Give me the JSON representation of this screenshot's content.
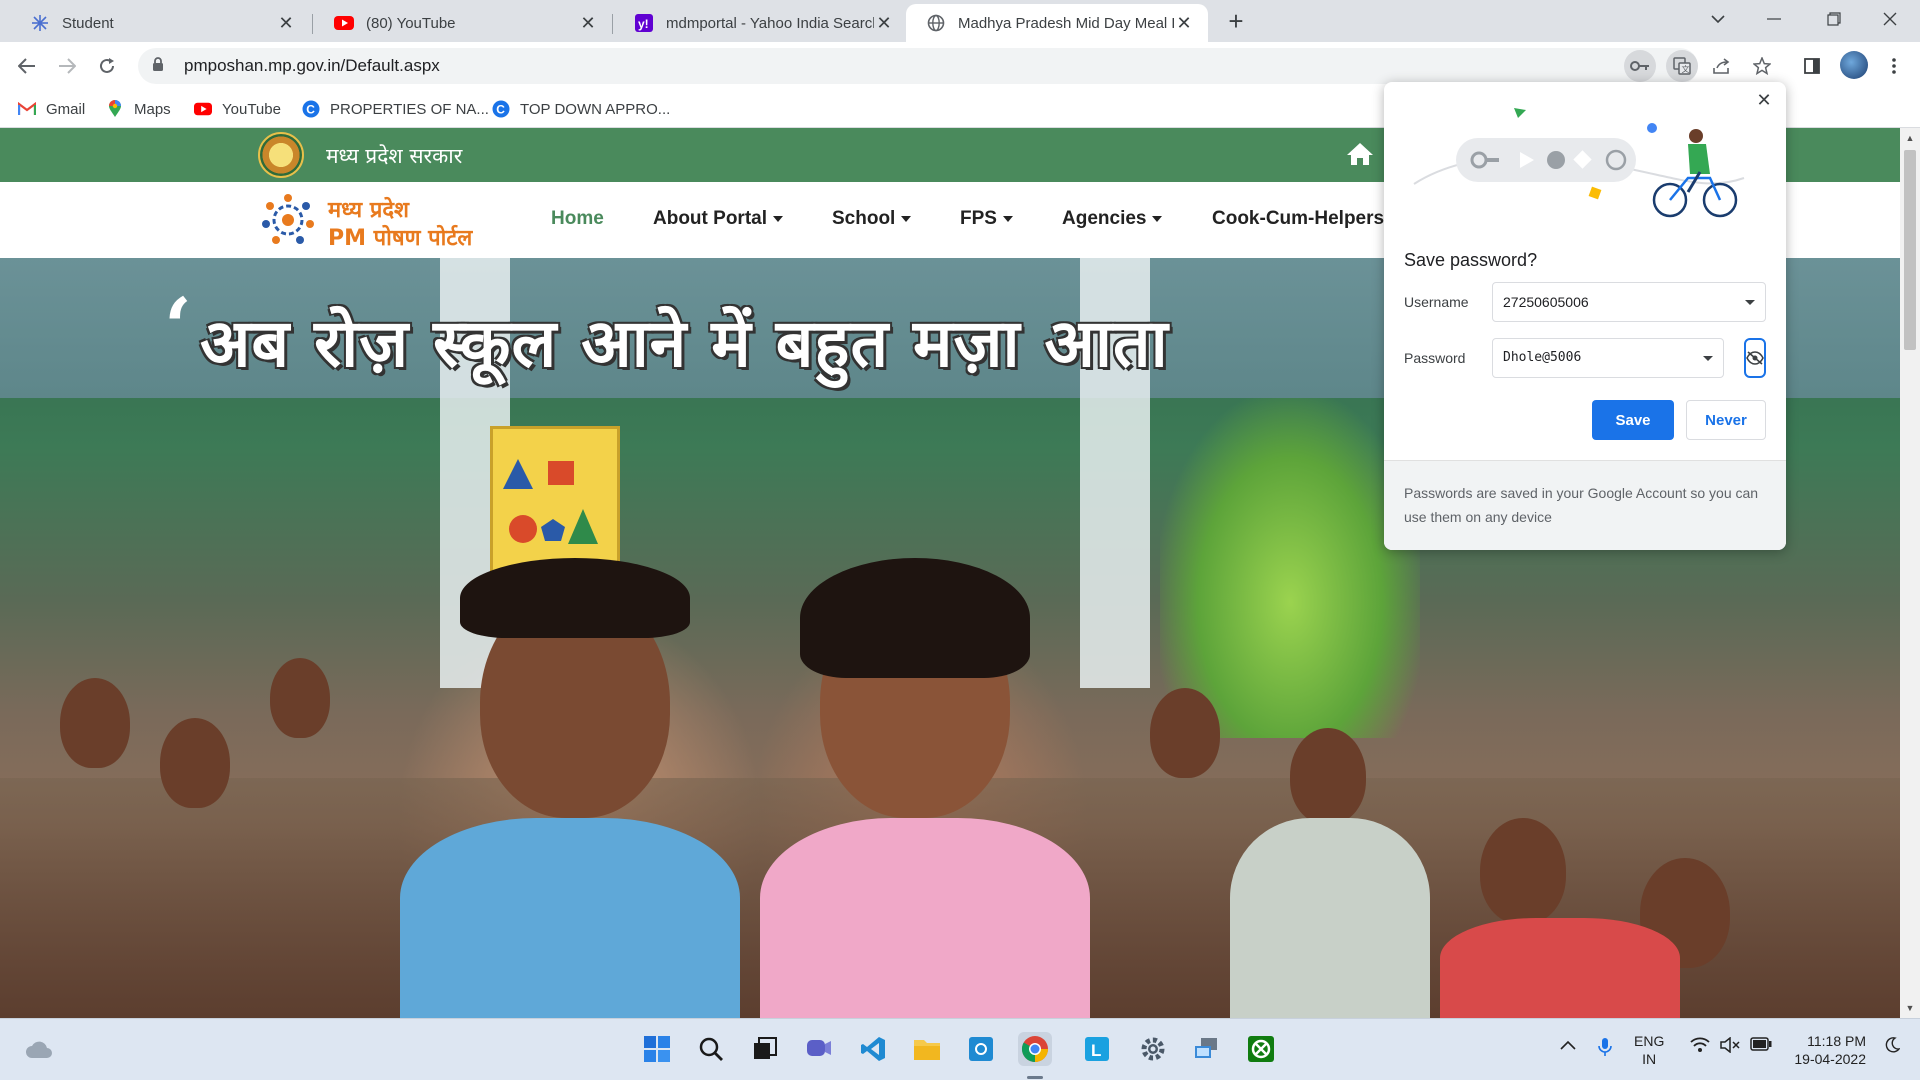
{
  "browser": {
    "tabs": [
      {
        "title": "Student",
        "icon": "snowflake-icon"
      },
      {
        "title": "(80) YouTube",
        "icon": "youtube-icon"
      },
      {
        "title": "mdmportal - Yahoo India Search",
        "icon": "yahoo-icon"
      },
      {
        "title": "Madhya Pradesh Mid Day Meal P",
        "icon": "globe-icon",
        "active": true
      }
    ],
    "url": "pmposhan.mp.gov.in/Default.aspx",
    "bookmarks": [
      {
        "label": "Gmail",
        "icon": "gmail-icon"
      },
      {
        "label": "Maps",
        "icon": "maps-icon"
      },
      {
        "label": "YouTube",
        "icon": "youtube-icon"
      },
      {
        "label": "PROPERTIES OF NA...",
        "icon": "bookmark-c-icon"
      },
      {
        "label": "TOP DOWN APPRO...",
        "icon": "bookmark-c-icon"
      }
    ]
  },
  "site": {
    "gov_title": "मध्य प्रदेश सरकार",
    "logo_line1": "मध्य प्रदेश",
    "logo_line2": "PM पोषण पोर्टल",
    "menu": [
      {
        "label": "Home",
        "active": true,
        "dropdown": false
      },
      {
        "label": "About Portal",
        "dropdown": true
      },
      {
        "label": "School",
        "dropdown": true
      },
      {
        "label": "FPS",
        "dropdown": true
      },
      {
        "label": "Agencies",
        "dropdown": true
      },
      {
        "label": "Cook-Cum-Helpers",
        "dropdown": false
      }
    ],
    "hero_slogan": "अब रोज़ स्कूल आने में बहुत मज़ा आता",
    "hero_quote_mark": "‘"
  },
  "password_popup": {
    "title": "Save password?",
    "username_label": "Username",
    "username_value": "27250605006",
    "password_label": "Password",
    "password_value": "Dhole@5006",
    "save_label": "Save",
    "never_label": "Never",
    "footer": "Passwords are saved in your Google Account so you can use them on any device"
  },
  "taskbar": {
    "lang_line1": "ENG",
    "lang_line2": "IN",
    "time": "11:18 PM",
    "date": "19-04-2022"
  },
  "colors": {
    "gov_green": "#4a8a5c",
    "logo_orange": "#e87a1e",
    "chrome_blue": "#1a73e8"
  }
}
